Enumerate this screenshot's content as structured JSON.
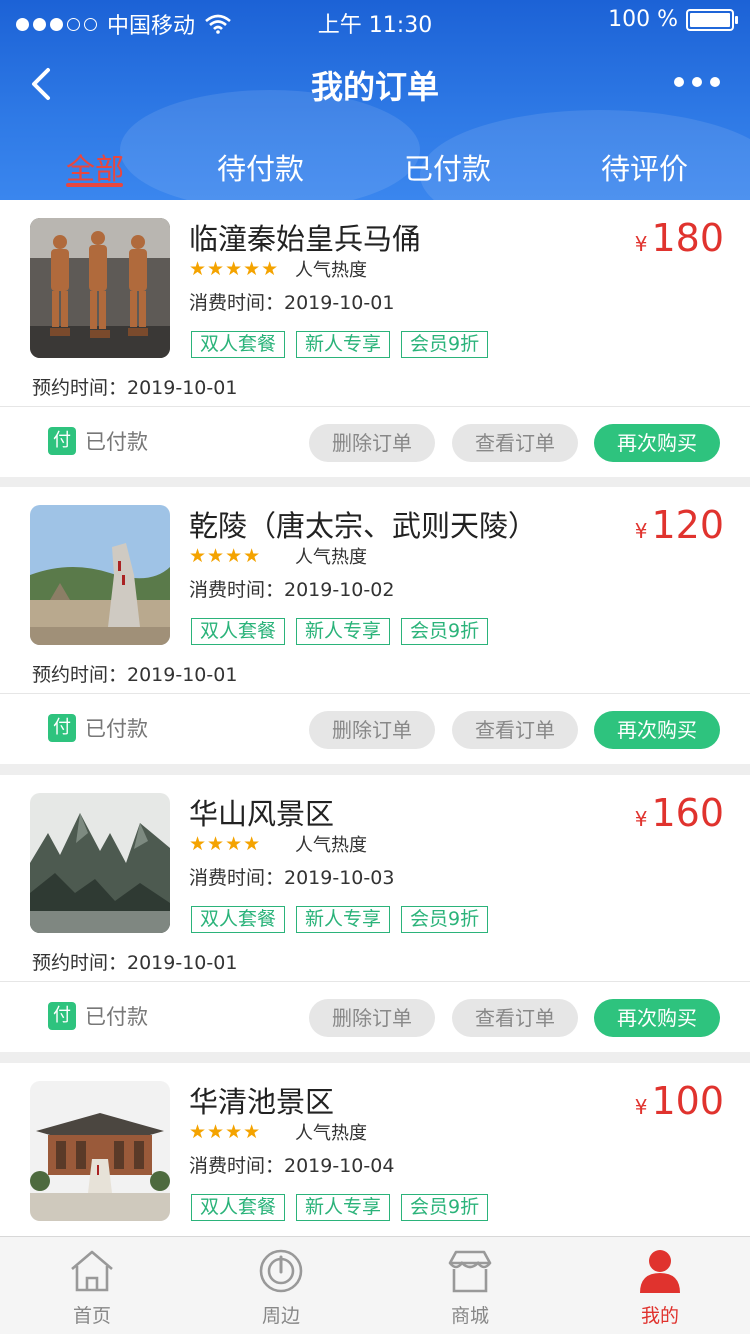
{
  "status_bar": {
    "carrier": "中国移动",
    "time": "上午 11:30",
    "battery": "100 %"
  },
  "nav": {
    "title": "我的订单"
  },
  "tabs": [
    {
      "label": "全部",
      "active": true
    },
    {
      "label": "待付款",
      "active": false
    },
    {
      "label": "已付款",
      "active": false
    },
    {
      "label": "待评价",
      "active": false
    }
  ],
  "orders": [
    {
      "title": "临潼秦始皇兵马俑",
      "currency": "¥",
      "price": "180",
      "stars": 5,
      "star_text": "★★★★★",
      "rating_label": "人气热度",
      "consume_time": "消费时间：2019-10-01",
      "tags": [
        "双人套餐",
        "新人专享",
        "会员9折"
      ],
      "booking_time": "预约时间：2019-10-01",
      "status_icon": "付",
      "status": "已付款",
      "delete_label": "删除订单",
      "view_label": "查看订单",
      "rebuy_label": "再次购买"
    },
    {
      "title": "乾陵（唐太宗、武则天陵）",
      "currency": "¥",
      "price": "120",
      "stars": 4,
      "star_text": "★★★★",
      "rating_label": "人气热度",
      "consume_time": "消费时间：2019-10-02",
      "tags": [
        "双人套餐",
        "新人专享",
        "会员9折"
      ],
      "booking_time": "预约时间：2019-10-01",
      "status_icon": "付",
      "status": "已付款",
      "delete_label": "删除订单",
      "view_label": "查看订单",
      "rebuy_label": "再次购买"
    },
    {
      "title": "华山风景区",
      "currency": "¥",
      "price": "160",
      "stars": 4,
      "star_text": "★★★★",
      "rating_label": "人气热度",
      "consume_time": "消费时间：2019-10-03",
      "tags": [
        "双人套餐",
        "新人专享",
        "会员9折"
      ],
      "booking_time": "预约时间：2019-10-01",
      "status_icon": "付",
      "status": "已付款",
      "delete_label": "删除订单",
      "view_label": "查看订单",
      "rebuy_label": "再次购买"
    },
    {
      "title": "华清池景区",
      "currency": "¥",
      "price": "100",
      "stars": 4,
      "star_text": "★★★★",
      "rating_label": "人气热度",
      "consume_time": "消费时间：2019-10-04",
      "tags": [
        "双人套餐",
        "新人专享",
        "会员9折"
      ]
    }
  ],
  "tabbar": [
    {
      "label": "首页",
      "icon": "home-icon",
      "active": false
    },
    {
      "label": "周边",
      "icon": "nearby-icon",
      "active": false
    },
    {
      "label": "商城",
      "icon": "store-icon",
      "active": false
    },
    {
      "label": "我的",
      "icon": "profile-icon",
      "active": true
    }
  ],
  "colors": {
    "header_blue": "#2f7ae6",
    "accent_red": "#e0332e",
    "active_tab_red": "#e8473f",
    "green": "#2ec37e",
    "star": "#f4a300"
  }
}
